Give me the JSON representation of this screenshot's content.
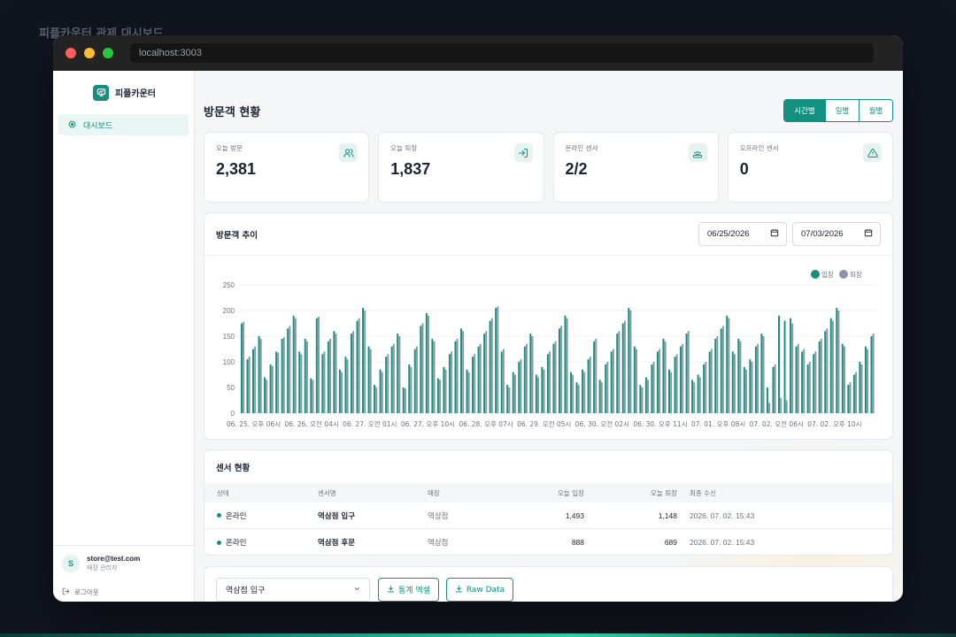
{
  "page_caption": "피플카운터 관제 대시보드",
  "browser": {
    "url": "localhost:3003"
  },
  "sidebar": {
    "brand": "피플카운터",
    "nav": [
      {
        "label": "대시보드",
        "icon": "dashboard-icon",
        "active": true
      }
    ],
    "user": {
      "initial": "S",
      "email": "store@test.com",
      "role": "매장 관리자"
    },
    "logout_label": "로그아웃"
  },
  "header": {
    "title": "방문객 현황",
    "range_tabs": [
      {
        "label": "시간별",
        "active": true
      },
      {
        "label": "일별",
        "active": false
      },
      {
        "label": "월별",
        "active": false
      }
    ]
  },
  "stats": [
    {
      "label": "오늘 방문",
      "value": "2,381",
      "icon": "users-icon"
    },
    {
      "label": "오늘 퇴장",
      "value": "1,837",
      "icon": "exit-door-icon"
    },
    {
      "label": "온라인 센서",
      "value": "2/2",
      "icon": "wifi-signal-icon"
    },
    {
      "label": "오프라인 센서",
      "value": "0",
      "icon": "warning-triangle-icon"
    }
  ],
  "trend": {
    "title": "방문객 추이",
    "start_date": "06/25/2026",
    "end_date": "07/03/2026"
  },
  "chart_data": {
    "type": "bar",
    "ylim": [
      0,
      250
    ],
    "yticks": [
      0,
      50,
      100,
      150,
      200,
      250
    ],
    "x_tick_labels": [
      "06. 25. 오후 06시",
      "06. 26. 오전 04시",
      "06. 27. 오전 01시",
      "06. 27. 오후 10시",
      "06. 28. 오후 07시",
      "06. 29. 오전 05시",
      "06. 30. 오전 02시",
      "06. 30. 오후 11시",
      "07. 01. 오후 08시",
      "07. 02. 오전 06시",
      "07. 02. 오후 10시"
    ],
    "grid": true,
    "legend_position": "top-right",
    "series": [
      {
        "name": "입장",
        "color": "#13907f",
        "values": [
          175,
          105,
          125,
          150,
          70,
          95,
          120,
          145,
          165,
          190,
          120,
          145,
          68,
          185,
          115,
          140,
          160,
          85,
          110,
          155,
          180,
          205,
          130,
          55,
          85,
          110,
          130,
          155,
          50,
          95,
          125,
          170,
          195,
          145,
          68,
          90,
          115,
          140,
          165,
          85,
          110,
          130,
          155,
          180,
          205,
          120,
          55,
          80,
          100,
          130,
          155,
          75,
          90,
          115,
          135,
          165,
          190,
          80,
          60,
          85,
          105,
          140,
          65,
          95,
          120,
          155,
          175,
          205,
          130,
          55,
          70,
          95,
          120,
          145,
          85,
          110,
          130,
          155,
          65,
          75,
          95,
          120,
          145,
          165,
          190,
          120,
          145,
          90,
          105,
          130,
          155,
          50,
          90,
          190,
          180,
          185,
          130,
          120,
          95,
          115,
          140,
          160,
          185,
          205,
          135,
          55,
          75,
          100,
          130,
          150
        ]
      },
      {
        "name": "퇴장",
        "color": "#8a96a8",
        "values": [
          178,
          110,
          130,
          145,
          65,
          92,
          118,
          148,
          170,
          185,
          115,
          140,
          65,
          188,
          120,
          145,
          155,
          80,
          105,
          160,
          185,
          200,
          125,
          50,
          80,
          115,
          135,
          150,
          48,
          90,
          130,
          175,
          190,
          140,
          65,
          85,
          120,
          145,
          160,
          80,
          115,
          135,
          160,
          185,
          208,
          125,
          50,
          75,
          105,
          135,
          150,
          70,
          85,
          120,
          140,
          170,
          185,
          75,
          55,
          80,
          110,
          145,
          60,
          100,
          125,
          160,
          180,
          200,
          125,
          50,
          65,
          100,
          125,
          140,
          80,
          115,
          135,
          160,
          60,
          70,
          100,
          125,
          150,
          170,
          185,
          115,
          140,
          85,
          100,
          135,
          150,
          20,
          95,
          30,
          25,
          175,
          135,
          125,
          100,
          120,
          145,
          165,
          180,
          200,
          130,
          60,
          80,
          95,
          125,
          155
        ]
      }
    ]
  },
  "sensors": {
    "title": "센서 현황",
    "columns": [
      "상태",
      "센서명",
      "매장",
      "오늘 입장",
      "오늘 퇴장",
      "최종 수신"
    ],
    "rows": [
      {
        "status": "온라인",
        "name": "역삼점 입구",
        "store": "역삼점",
        "in": "1,493",
        "out": "1,148",
        "last": "2026. 07. 02. 15:43"
      },
      {
        "status": "온라인",
        "name": "역삼점 후문",
        "store": "역삼점",
        "in": "888",
        "out": "689",
        "last": "2026. 07. 02. 15:43"
      }
    ]
  },
  "download": {
    "selected_sensor": "역삼점 입구",
    "stats_excel_label": "통계 엑셀",
    "raw_data_label": "Raw Data"
  }
}
